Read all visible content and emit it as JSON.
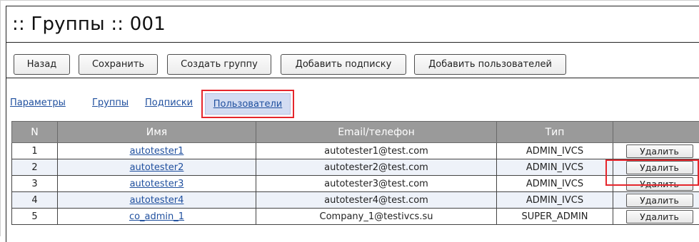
{
  "header": {
    "title": ":: Группы :: 001"
  },
  "toolbar": {
    "back_label": "Назад",
    "save_label": "Сохранить",
    "create_group_label": "Создать группу",
    "add_subscription_label": "Добавить подписку",
    "add_users_label": "Добавить пользователей"
  },
  "tabs": {
    "params": "Параметры",
    "groups": "Группы",
    "subscriptions": "Подписки",
    "users": "Пользователи",
    "active": "users"
  },
  "table": {
    "columns": [
      "N",
      "Имя",
      "Email/телефон",
      "Тип",
      ""
    ],
    "rows": [
      {
        "n": "1",
        "name": "autotester1",
        "email": "autotester1@test.com",
        "type": "ADMIN_IVCS",
        "action": "Удалить"
      },
      {
        "n": "2",
        "name": "autotester2",
        "email": "autotester2@test.com",
        "type": "ADMIN_IVCS",
        "action": "Удалить"
      },
      {
        "n": "3",
        "name": "autotester3",
        "email": "autotester3@test.com",
        "type": "ADMIN_IVCS",
        "action": "Удалить"
      },
      {
        "n": "4",
        "name": "autotester4",
        "email": "autotester4@test.com",
        "type": "ADMIN_IVCS",
        "action": "Удалить"
      },
      {
        "n": "5",
        "name": "co_admin_1",
        "email": "Company_1@testivcs.su",
        "type": "SUPER_ADMIN",
        "action": "Удалить"
      }
    ]
  },
  "colors": {
    "highlight": "#e5262c",
    "link": "#1f4f9e",
    "header_bg": "#9a9a9a",
    "alt_row_bg": "#eef2f9",
    "active_tab_bg": "#d3dcf2"
  }
}
